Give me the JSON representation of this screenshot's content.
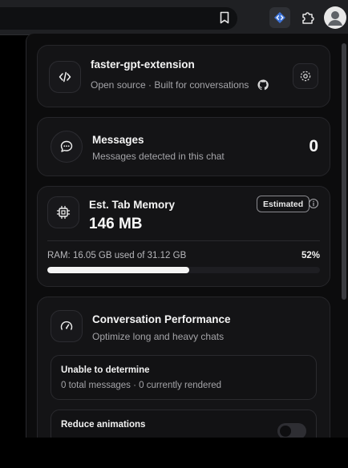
{
  "browser": {
    "icons": {
      "bookmark": "bookmark-icon",
      "extension": "code-icon",
      "extensions_menu": "puzzle-icon",
      "profile": "avatar-icon"
    },
    "accent_color": "#8ab4f8"
  },
  "header": {
    "title": "faster-gpt-extension",
    "subtitle": "Open source · Built for conversations",
    "icon": "code-icon",
    "github_icon": "github-icon",
    "settings_icon": "gear-icon"
  },
  "messages": {
    "title": "Messages",
    "subtitle": "Messages detected in this chat",
    "count": "0",
    "icon": "chat-bubble-icon"
  },
  "memory": {
    "title": "Est. Tab Memory",
    "value": "146 MB",
    "badge": "Estimated",
    "ram_text": "RAM: 16.05 GB used of 31.12 GB",
    "ram_percent_label": "52%",
    "ram_fraction": 0.52,
    "icon": "chip-icon",
    "info_icon": "info-icon"
  },
  "performance": {
    "title": "Conversation Performance",
    "subtitle": "Optimize long and heavy chats",
    "icon": "gauge-icon",
    "status": {
      "title": "Unable to determine",
      "detail": "0 total messages · 0 currently rendered"
    },
    "reduce_animations": {
      "label": "Reduce animations",
      "enabled": false
    }
  }
}
